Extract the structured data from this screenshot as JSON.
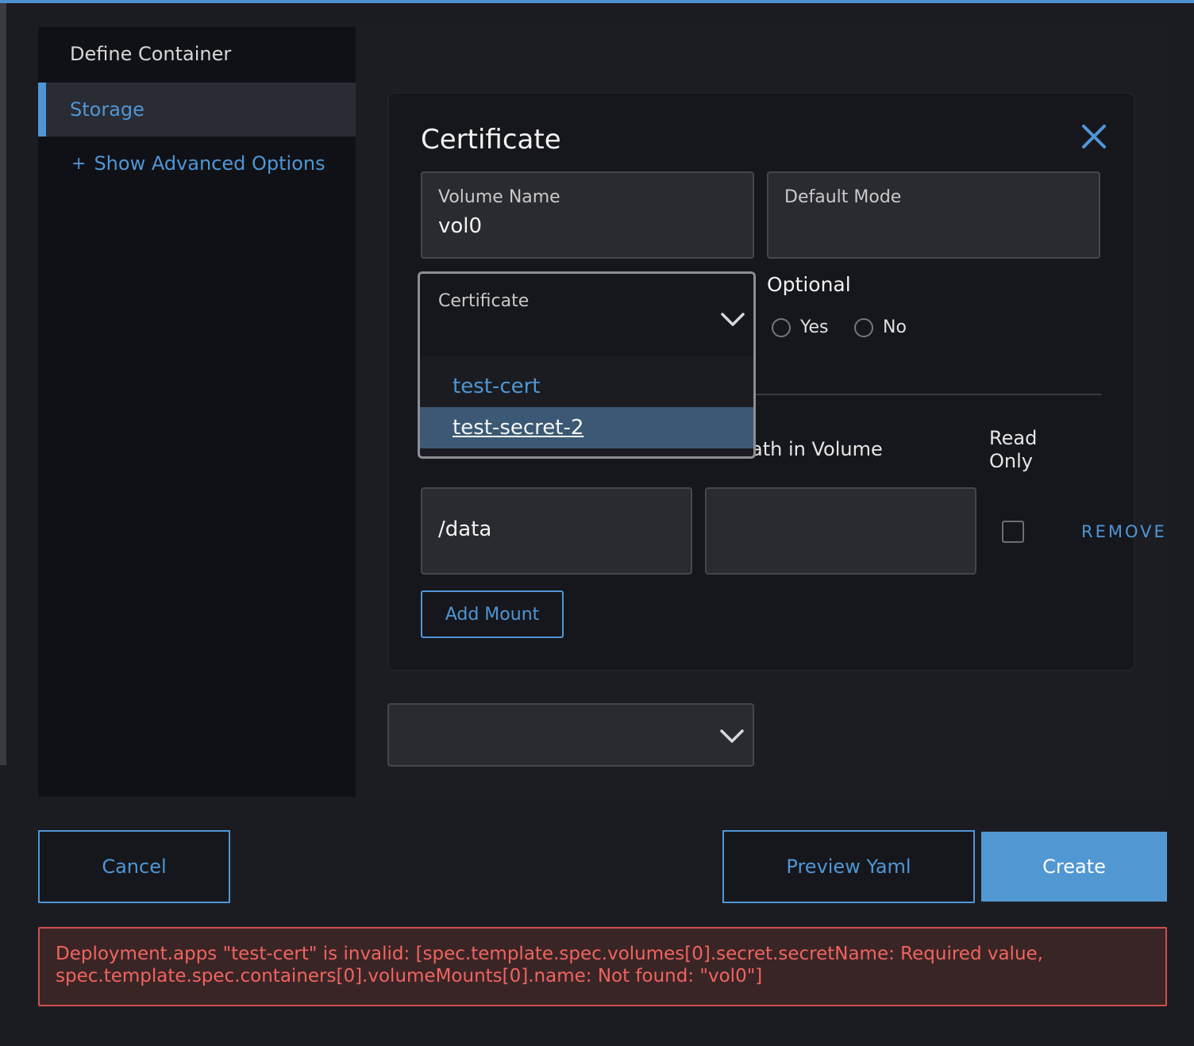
{
  "sidebar": {
    "define_container": "Define Container",
    "storage": "Storage",
    "show_advanced_plus": "+",
    "show_advanced": "Show Advanced Options"
  },
  "card": {
    "title": "Certificate",
    "volume_name": {
      "label": "Volume Name",
      "value": "vol0"
    },
    "default_mode": {
      "label": "Default Mode",
      "value": ""
    },
    "certificate_select": {
      "label": "Certificate",
      "options": [
        "test-cert",
        "test-secret-2"
      ],
      "highlighted": "test-secret-2"
    },
    "optional": {
      "label": "Optional",
      "yes": "Yes",
      "no": "No"
    },
    "mounts": {
      "header_path_in_volume": "ath in Volume",
      "header_read_only": "Read Only",
      "rows": [
        {
          "mount_point": "/data",
          "sub_path": "",
          "read_only": false,
          "remove_label": "REMOVE"
        }
      ],
      "add_mount_label": "Add Mount"
    }
  },
  "footer": {
    "cancel": "Cancel",
    "preview_yaml": "Preview Yaml",
    "create": "Create"
  },
  "error_message": "Deployment.apps \"test-cert\" is invalid: [spec.template.spec.volumes[0].secret.secretName: Required value, spec.template.spec.containers[0].volumeMounts[0].name: Not found: \"vol0\"]",
  "colors": {
    "accent": "#4f96d6",
    "error": "#f0645f",
    "background": "#1b1c21"
  }
}
